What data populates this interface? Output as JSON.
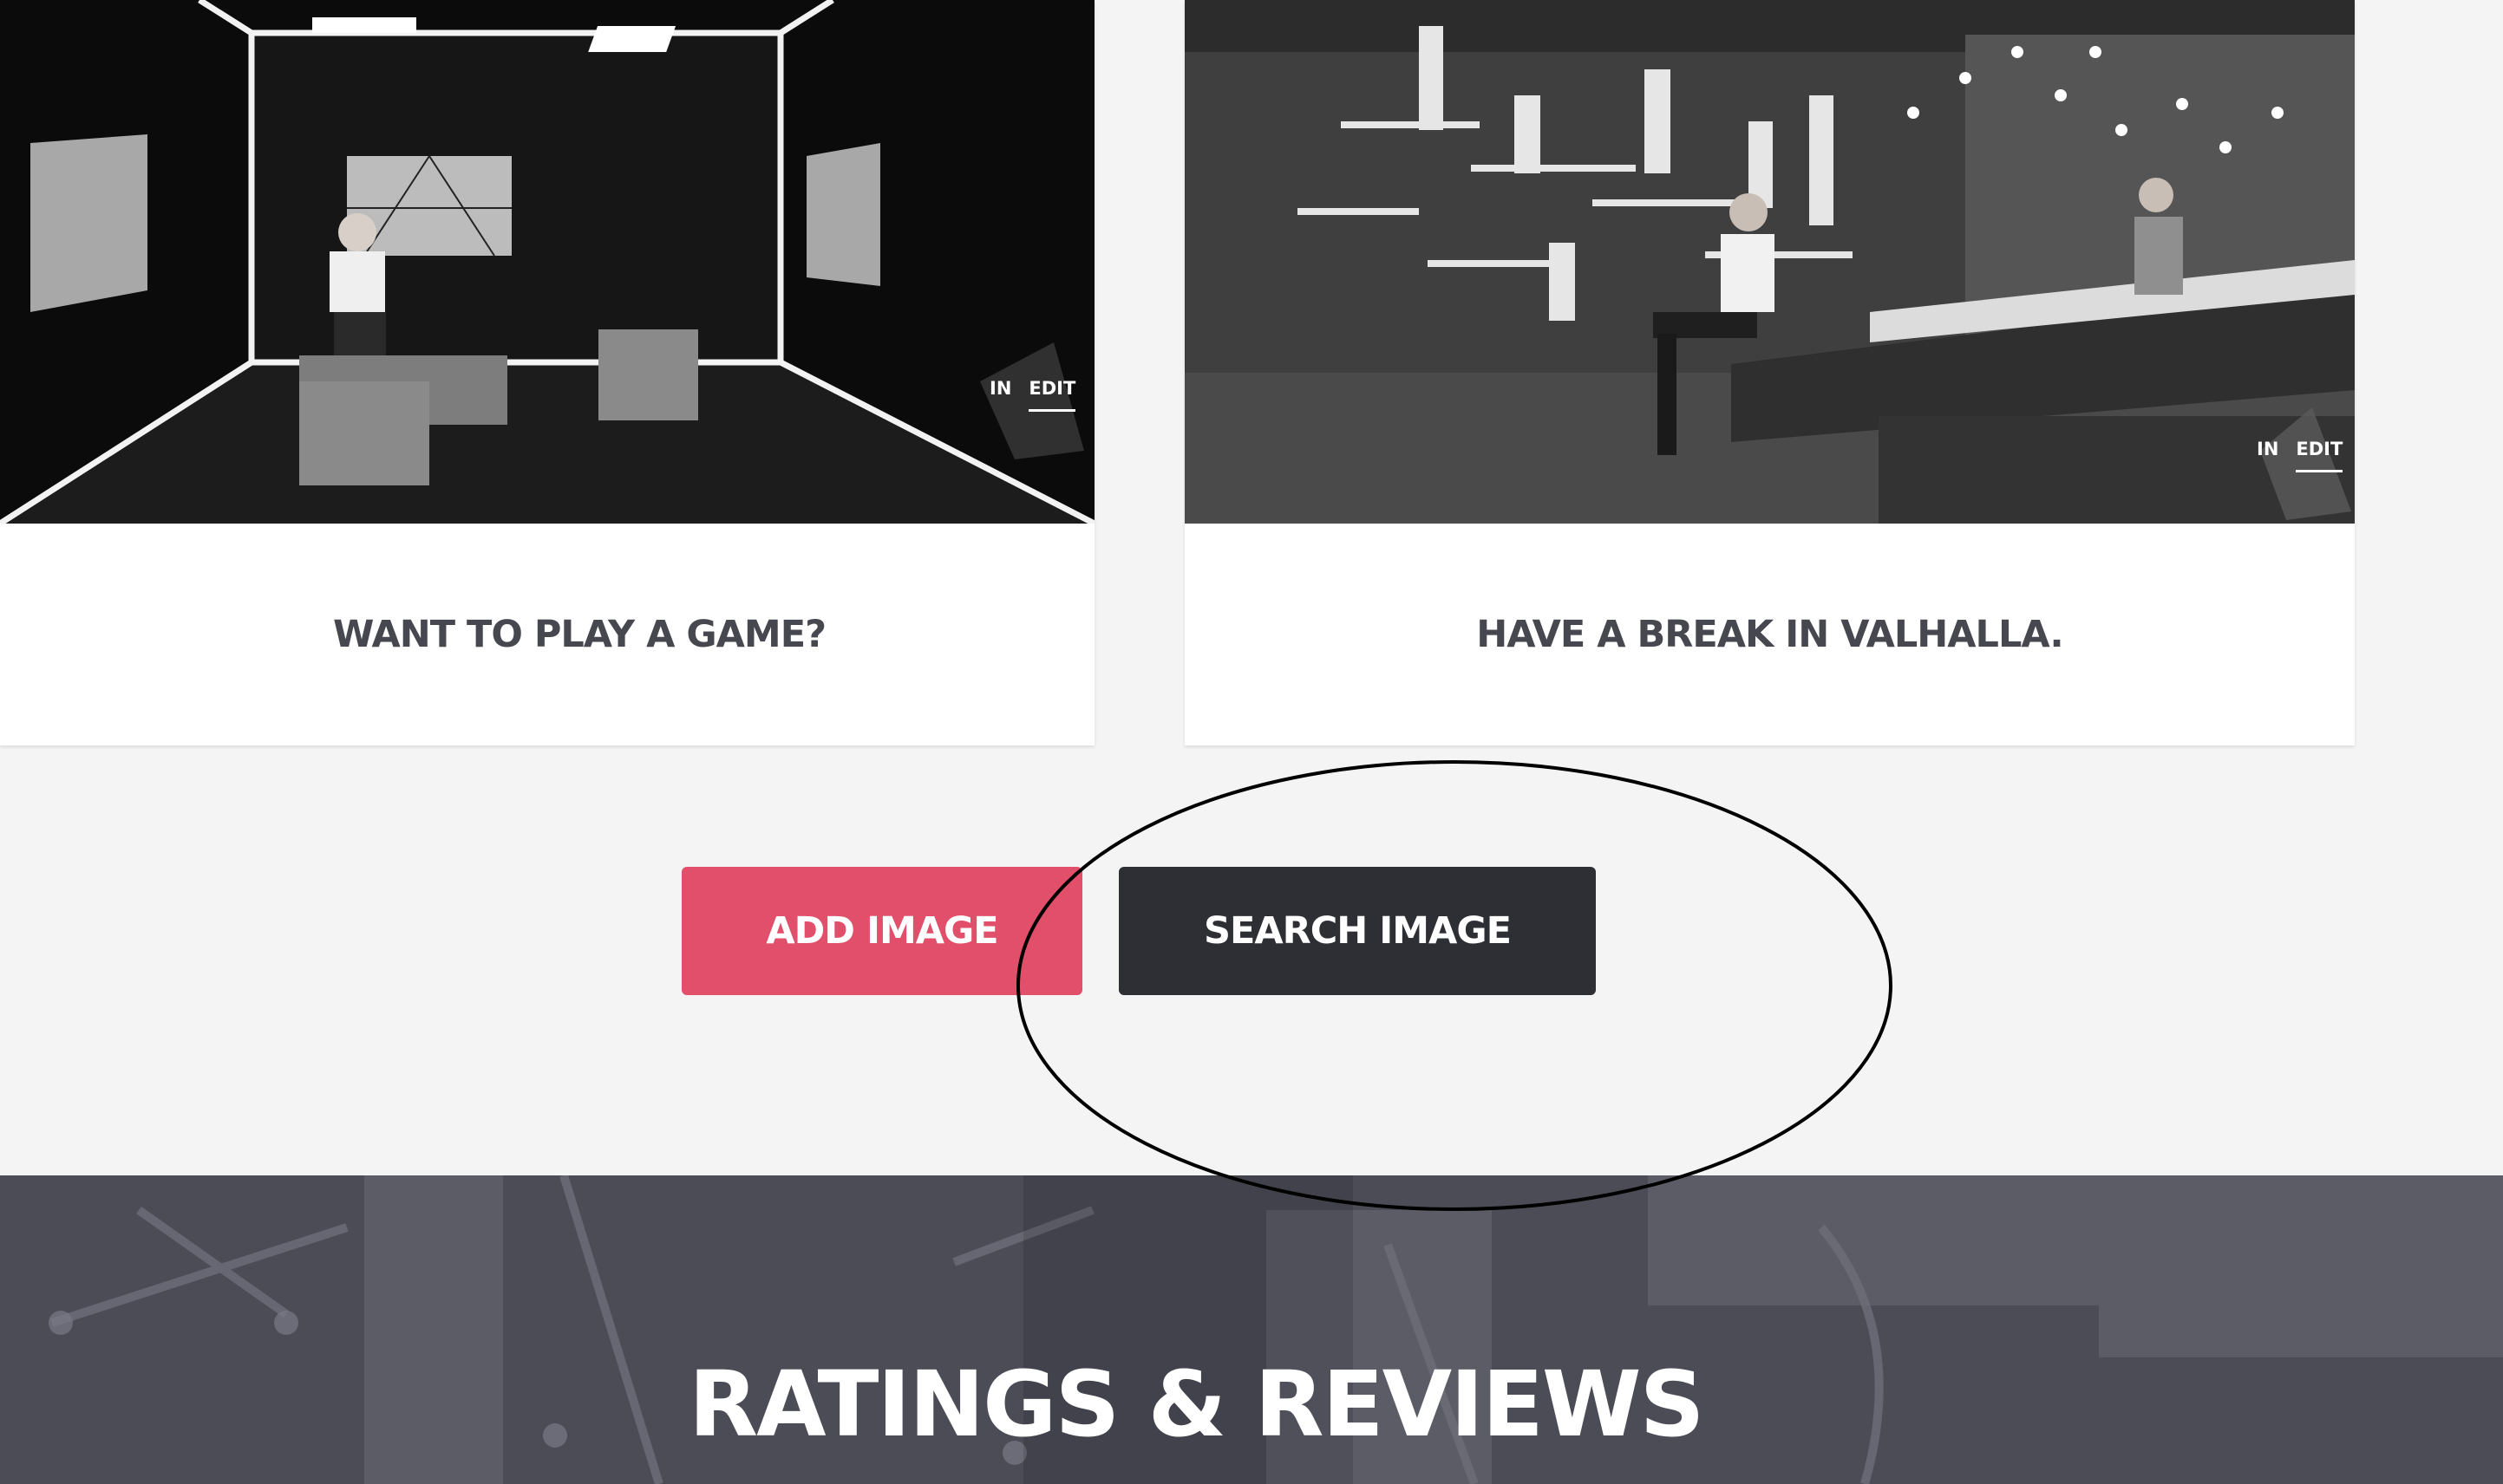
{
  "gallery": {
    "cards": [
      {
        "title": "WANT TO PLAY A GAME?",
        "watermark_left": "IN",
        "watermark_right": "EDIT"
      },
      {
        "title": "HAVE A BREAK IN VALHALLA.",
        "watermark_left": "IN",
        "watermark_right": "EDIT"
      }
    ]
  },
  "actions": {
    "add_label": "ADD IMAGE",
    "search_label": "SEARCH IMAGE"
  },
  "ratings": {
    "title": "RATINGS & REVIEWS"
  },
  "colors": {
    "add_button": "#e14f6a",
    "search_button": "#2e2e35",
    "page_background": "#f4f4f4",
    "ratings_overlay": "#4a4a55"
  }
}
